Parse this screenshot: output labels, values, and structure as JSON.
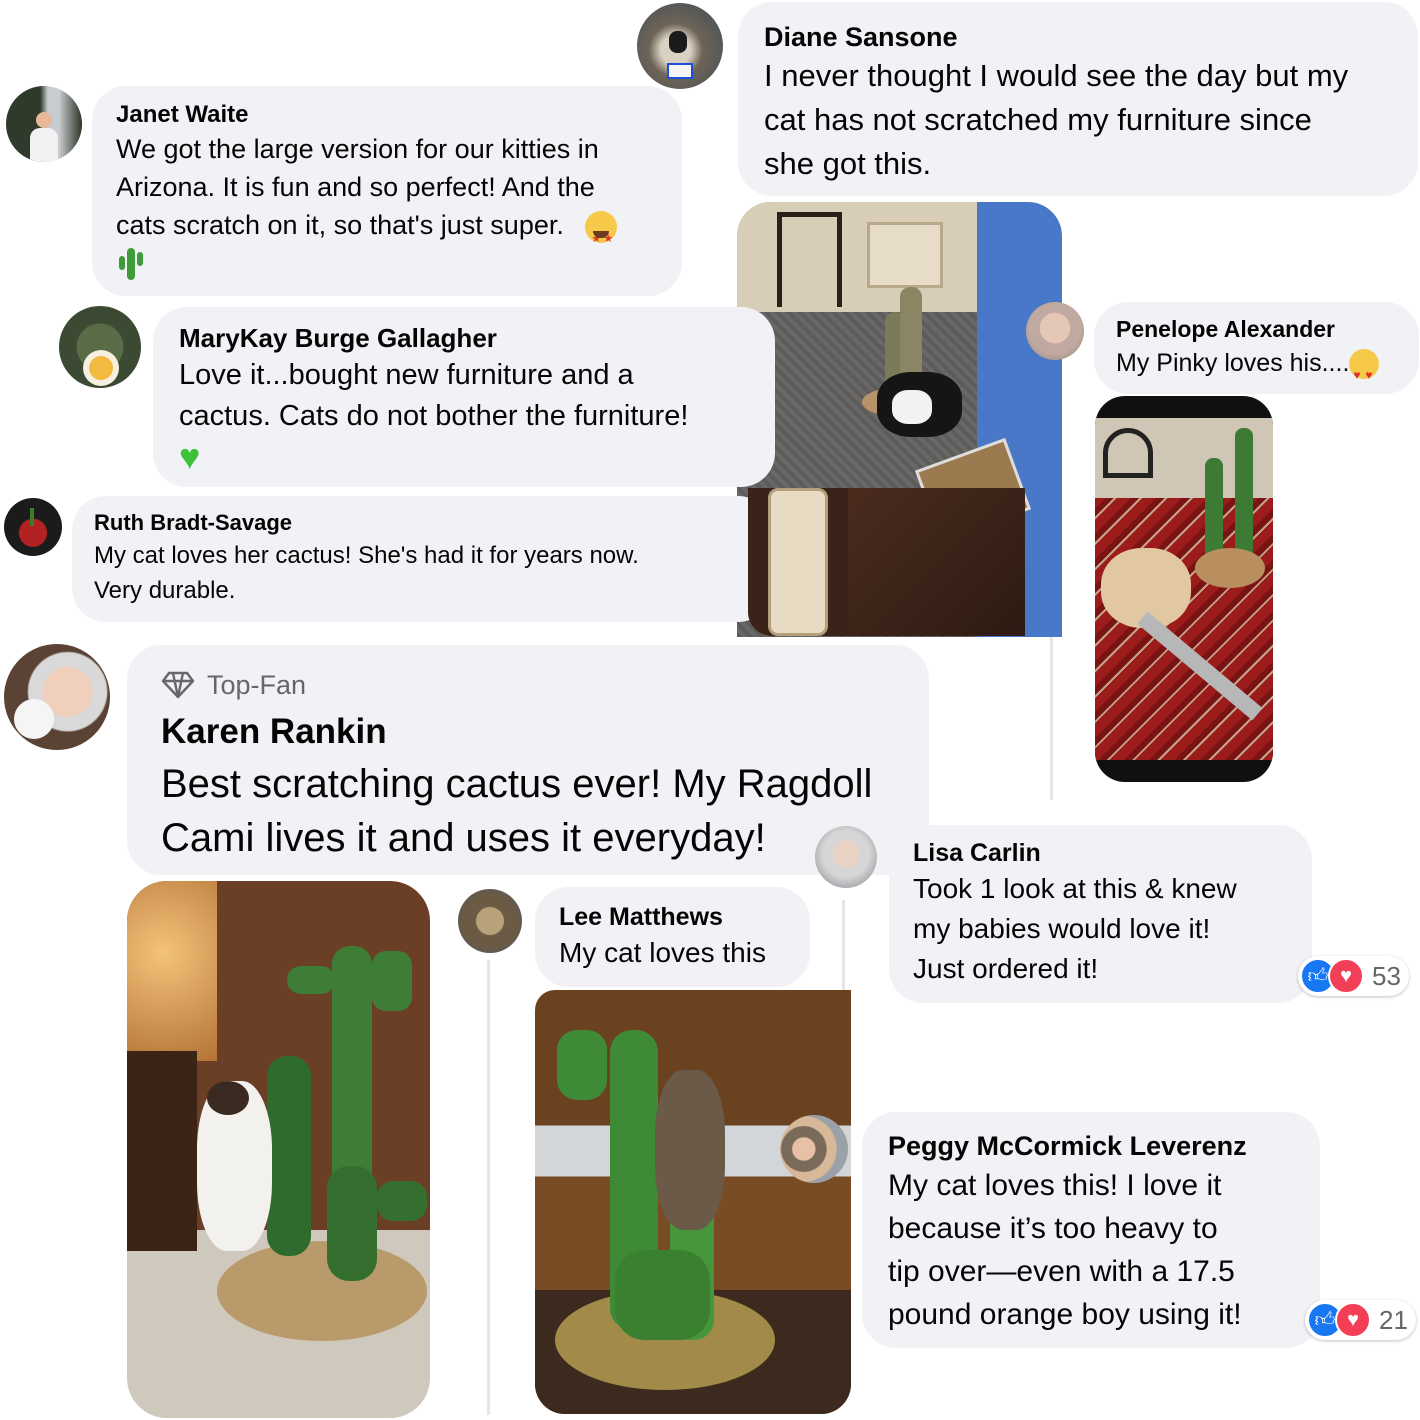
{
  "comments": {
    "diane": {
      "name": "Diane Sansone",
      "text_lines": [
        "I never thought I would see the day but my",
        "cat has not scratched my furniture since",
        "she got this."
      ]
    },
    "janet": {
      "name": "Janet Waite",
      "text_lines": [
        "We got the large version for our kitties in",
        "Arizona.  It is fun and so perfect!  And the",
        "cats scratch on it, so that's just super."
      ]
    },
    "marykay": {
      "name": "MaryKay Burge Gallagher",
      "text_lines": [
        "Love it...bought new furniture and a",
        "cactus. Cats do not bother the furniture!"
      ]
    },
    "penelope": {
      "name": "Penelope Alexander",
      "text": "My Pinky loves his...."
    },
    "ruth": {
      "name": "Ruth Bradt-Savage",
      "text_lines": [
        "My cat loves her cactus! She's had it for years now.",
        "Very durable."
      ]
    },
    "karen": {
      "badge": "Top-Fan",
      "name": "Karen Rankin",
      "text_lines": [
        "Best scratching cactus ever! My Ragdoll",
        "Cami lives it and uses it everyday!"
      ]
    },
    "lisa": {
      "name": "Lisa Carlin",
      "text_lines": [
        "Took 1 look at this & knew",
        "my babies would love it!",
        "Just ordered it!"
      ],
      "reaction_count": "53"
    },
    "lee": {
      "name": "Lee Matthews",
      "text": "My cat loves this"
    },
    "peggy": {
      "name": "Peggy McCormick Leverenz",
      "text_lines": [
        "My cat loves this! I love it",
        "because it’s too heavy to",
        "tip over—even with a 17.5",
        "pound orange boy using it!"
      ],
      "reaction_count": "21"
    }
  },
  "icons": {
    "like": "thumbs-up-icon",
    "love": "heart-icon",
    "badge": "diamond-icon",
    "cactus_emoji": "cactus-emoji",
    "heart_emoji": "green-heart-emoji",
    "star_eyes": "star-struck-emoji",
    "heart_eyes": "heart-eyes-cat-emoji"
  },
  "colors": {
    "bubble": "#f0f2f5",
    "like_blue": "#1877f2",
    "love_red": "#f33e58",
    "muted": "#65676b",
    "cactus_green": "#3f7d3a"
  }
}
